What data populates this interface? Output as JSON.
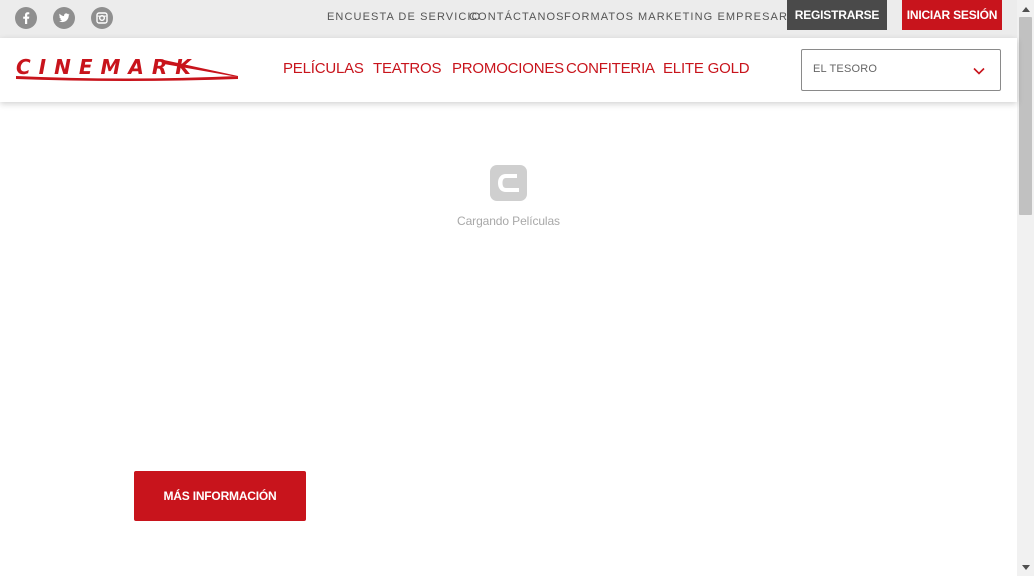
{
  "topbar": {
    "social": [
      {
        "name": "facebook-icon"
      },
      {
        "name": "twitter-icon"
      },
      {
        "name": "instagram-icon"
      }
    ],
    "links": [
      "ENCUESTA DE SERVICIO",
      "CONTÁCTANOS",
      "FORMATOS",
      "MARKETING EMPRESARIAL"
    ],
    "register_label": "REGISTRARSE",
    "login_label": "INICIAR SESIÓN"
  },
  "header": {
    "logo_text": "CINEMARK",
    "nav": [
      "PELÍCULAS",
      "TEATROS",
      "PROMOCIONES",
      "CONFITERIA",
      "ELITE GOLD"
    ],
    "theater_select": {
      "value": "EL TESORO",
      "icon": "chevron-down-icon"
    }
  },
  "main": {
    "loading_text": "Cargando Películas",
    "loader_icon": "cinemark-c-icon",
    "more_info_label": "MÁS INFORMACIÓN"
  },
  "colors": {
    "brand_red": "#c8141c",
    "topbar_bg": "#ececec",
    "dark_button": "#4a4a4a"
  }
}
